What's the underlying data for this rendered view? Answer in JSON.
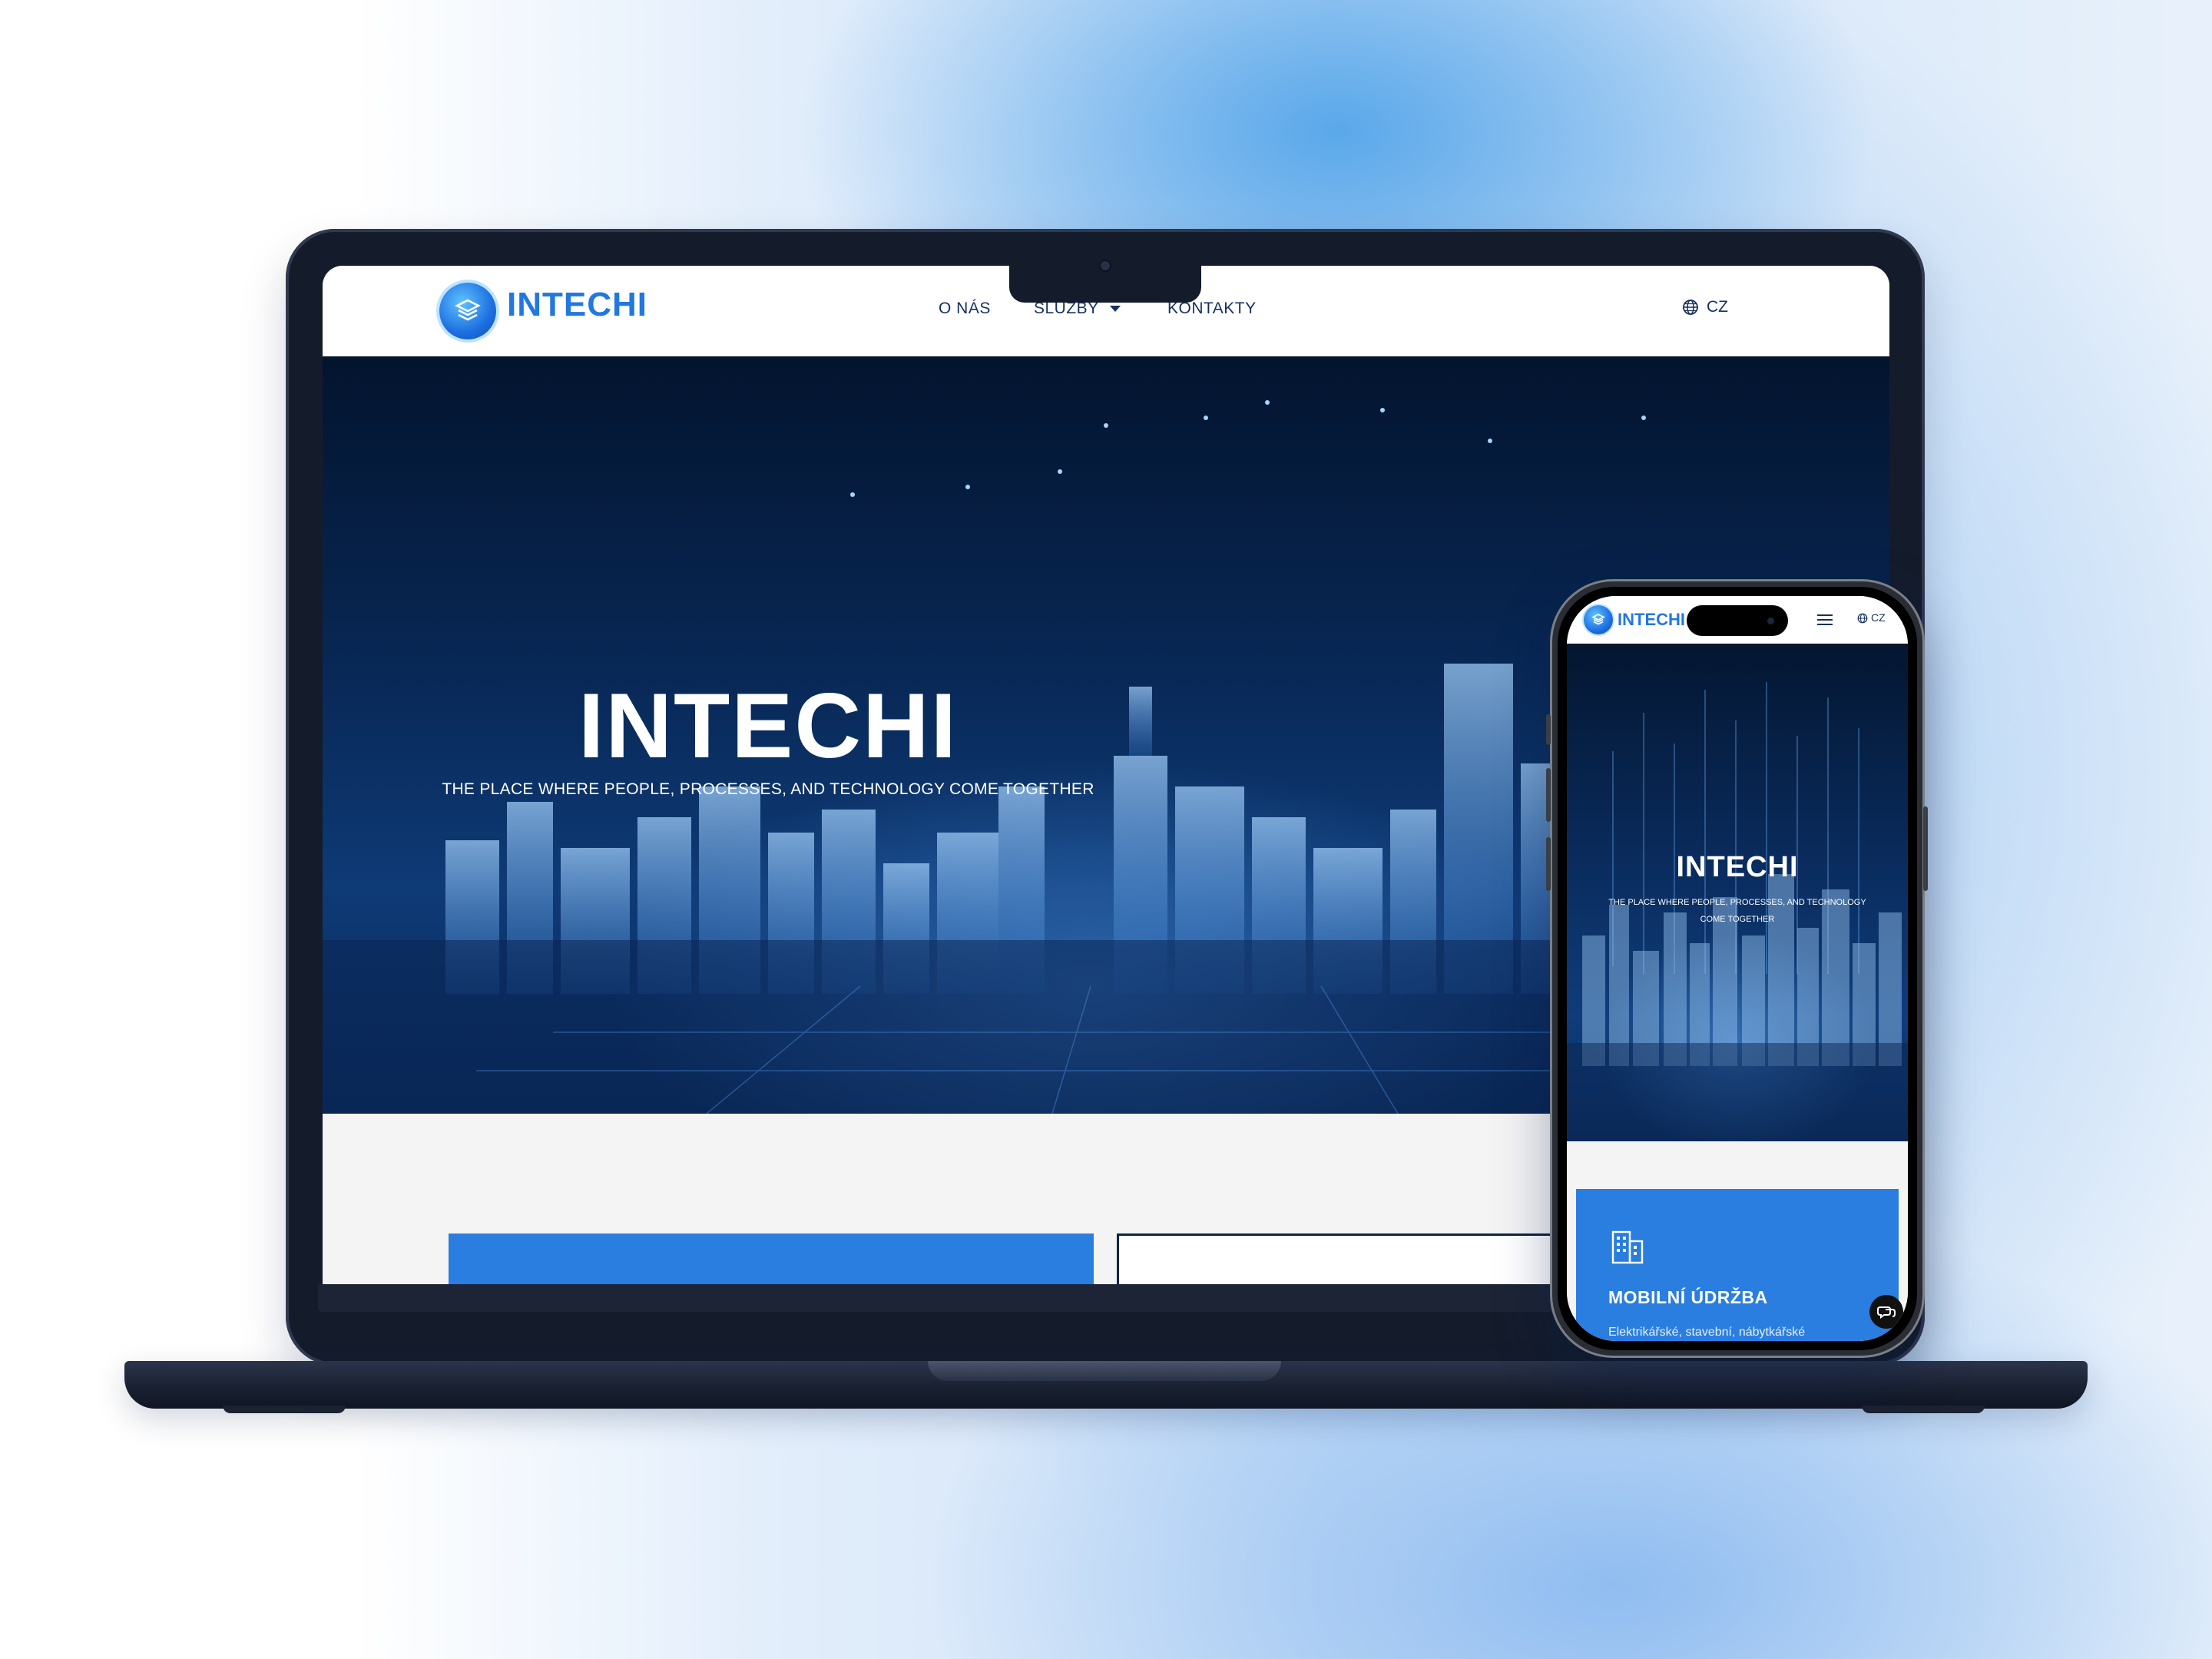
{
  "site": {
    "brand": "INTECHI",
    "nav": {
      "about": "O NÁS",
      "services": "SLUŽBY",
      "contacts": "KONTAKTY"
    },
    "language": "CZ",
    "hero": {
      "title": "INTECHI",
      "subtitle": "THE PLACE WHERE PEOPLE, PROCESSES, AND TECHNOLOGY COME TOGETHER"
    }
  },
  "mobile": {
    "brand": "INTECHI",
    "language": "CZ",
    "hero": {
      "title": "INTECHI",
      "subtitle_line1": "THE PLACE WHERE PEOPLE, PROCESSES, AND TECHNOLOGY",
      "subtitle_line2": "COME TOGETHER"
    },
    "card": {
      "title": "MOBILNÍ ÚDRŽBA",
      "text": "Elektrikářské, stavební, nábytkářské"
    }
  },
  "colors": {
    "brand_blue": "#2178e0",
    "card_blue": "#2a7ee0",
    "nav_text": "#14305e",
    "hero_dark": "#082754"
  },
  "icons": [
    "logo-layers-icon",
    "globe-icon",
    "dropdown-caret-icon",
    "hamburger-menu-icon",
    "building-icon",
    "chat-icon"
  ]
}
